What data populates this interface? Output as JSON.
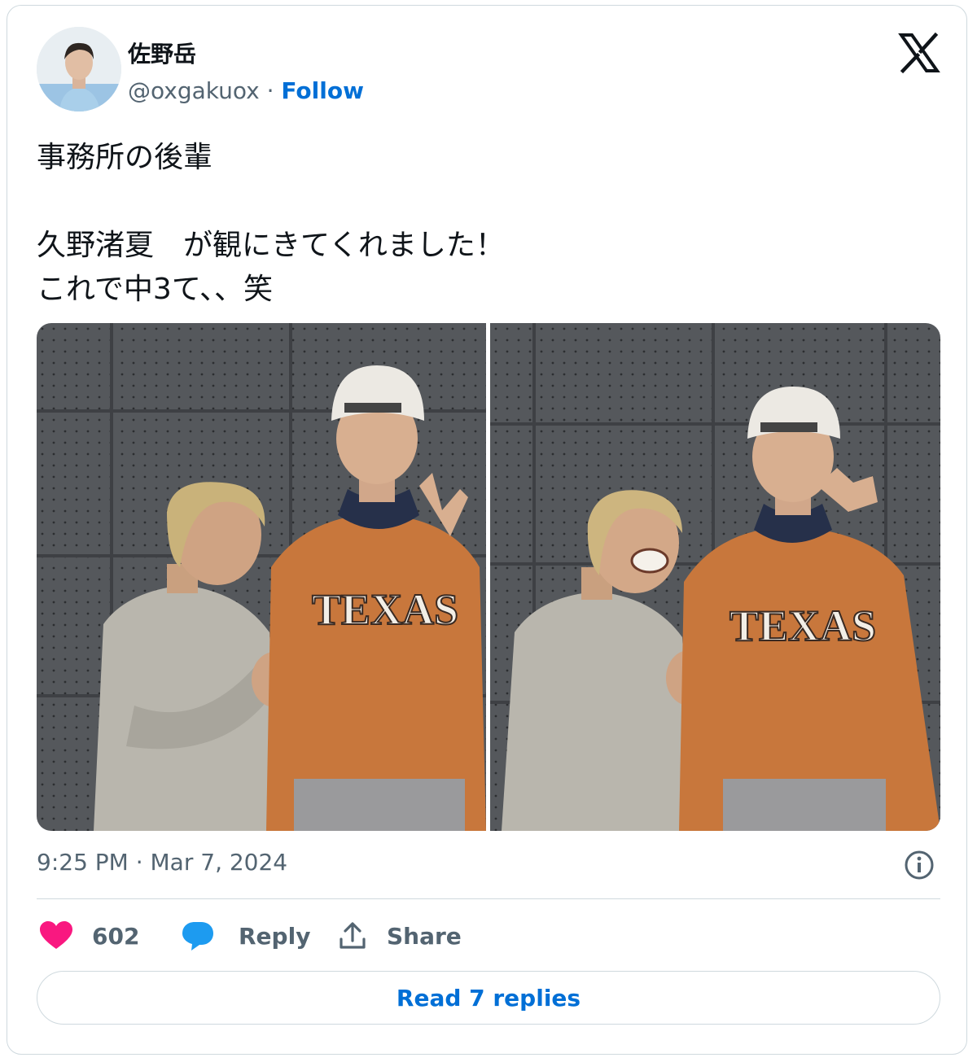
{
  "tweet": {
    "author_name": "佐野岳",
    "handle": "@oxgakuox",
    "separator": " · ",
    "follow_label": "Follow",
    "text_lines": [
      "事務所の後輩",
      "",
      "久野渚夏　が観にきてくれました！",
      "これで中3て、、笑"
    ],
    "timestamp": "9:25 PM · Mar 7, 2024",
    "photo_jersey_text": "TEXAS"
  },
  "actions": {
    "like_count": "602",
    "reply_label": "Reply",
    "share_label": "Share"
  },
  "read_replies_label": "Read 7 replies",
  "colors": {
    "accent": "#006fd6",
    "like": "#f91880",
    "reply_icon": "#1d9bf0",
    "text_primary": "#0f1419",
    "text_secondary": "#536471",
    "border": "#cfd9de"
  },
  "icons": [
    "x-logo-icon",
    "info-icon",
    "heart-icon",
    "reply-bubble-icon",
    "share-icon"
  ]
}
